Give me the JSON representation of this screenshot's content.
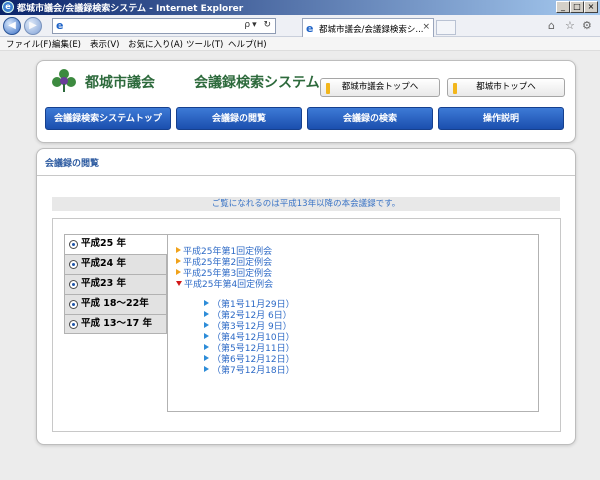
{
  "window": {
    "title": "都城市議会/会議録検索システム - Internet Explorer",
    "minimize": "_",
    "maximize": "□",
    "close": "×"
  },
  "browser": {
    "address_value": "",
    "address_tools": "ρ▾ ↻",
    "tab_label": "都城市議会/会議録検索シ...",
    "tab_close": "×",
    "icons": [
      "home-icon",
      "favorites-icon",
      "settings-icon"
    ]
  },
  "menu": [
    "ファイル(F)",
    "編集(E)",
    "表示(V)",
    "お気に入り(A)",
    "ツール(T)",
    "ヘルプ(H)"
  ],
  "header": {
    "logo_title": "都城市議会",
    "logo_sub": "会議録検索システム",
    "link_council_top": "都城市議会トップへ",
    "link_city_top": "都城市トップへ",
    "colors": {
      "logo_green": "#2d6a3c",
      "nav_blue": "#1b4fae",
      "link_bar": "#f2b61c"
    }
  },
  "nav": [
    "会議録検索システムトップ",
    "会議録の閲覧",
    "会議録の検索",
    "操作説明"
  ],
  "content": {
    "section_title": "会議録の閲覧",
    "notice": "ご覧になれるのは平成13年以降の本会議録です。",
    "years": [
      {
        "label": "平成25 年",
        "active": true
      },
      {
        "label": "平成24 年",
        "active": false
      },
      {
        "label": "平成23 年",
        "active": false
      },
      {
        "label": "平成 18～22年",
        "active": false
      },
      {
        "label": "平成 13～17 年",
        "active": false
      }
    ],
    "sessions": [
      {
        "label": "平成25年第1回定例会",
        "expanded": false
      },
      {
        "label": "平成25年第2回定例会",
        "expanded": false
      },
      {
        "label": "平成25年第3回定例会",
        "expanded": false
      },
      {
        "label": "平成25年第4回定例会",
        "expanded": true
      }
    ],
    "meetings": [
      "（第1号11月29日）",
      "（第2号12月 6日）",
      "（第3号12月 9日）",
      "（第4号12月10日）",
      "（第5号12月11日）",
      "（第6号12月12日）",
      "（第7号12月18日）"
    ]
  }
}
